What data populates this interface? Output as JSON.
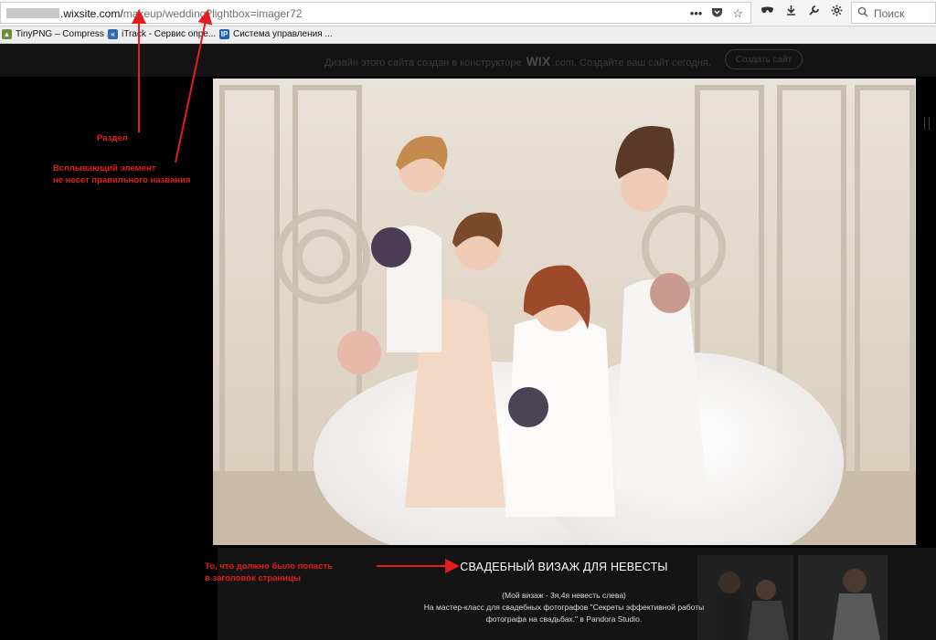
{
  "browser": {
    "url_domain": ".wixsite.com/",
    "url_path": "makeup/wedding?lightbox=imager72",
    "search_placeholder": "Поиск",
    "icons": [
      "more-icon",
      "pocket-icon",
      "star-icon",
      "mask-icon",
      "download-icon",
      "wrench-icon",
      "gear-icon"
    ]
  },
  "bookmarks": [
    {
      "label": "TinyPNG – Compress ...",
      "favicon_color": "#6b8f3a",
      "icon": "tinypng-icon"
    },
    {
      "label": "iTrack - Сервис опре...",
      "favicon_color": "#2d6db5",
      "icon": "itrack-icon"
    },
    {
      "label": "Система управления ...",
      "favicon_color": "#1f5fb8",
      "icon": "ip-icon"
    }
  ],
  "wix_banner": {
    "text_before": "Дизайн этого сайта создан в конструкторе",
    "logo": "WIX",
    "text_after": ".com. Создайте ваш сайт сегодня.",
    "button": "Создать сайт"
  },
  "lightbox": {
    "title": "СВАДЕБНЫЙ ВИЗАЖ ДЛЯ НЕВЕСТЫ",
    "line1": "(Мой визаж - 3я,4я невесть слева)",
    "line2": "На мастер-класс для свадебных фотографов \"Секреты эффективной работы",
    "line3": "фотографа на свадьбах.\" в Pandora Studio."
  },
  "annotations": {
    "section": "Раздел",
    "popup_line1": "Всплывающий элемент",
    "popup_line2": "не несет правильного названия",
    "title_line1": "То, что должно было попасть",
    "title_line2": "в заголовок страницы"
  },
  "colors": {
    "annotation": "#e21d1d",
    "page_bg": "#000000",
    "banner_bg": "#131313"
  }
}
